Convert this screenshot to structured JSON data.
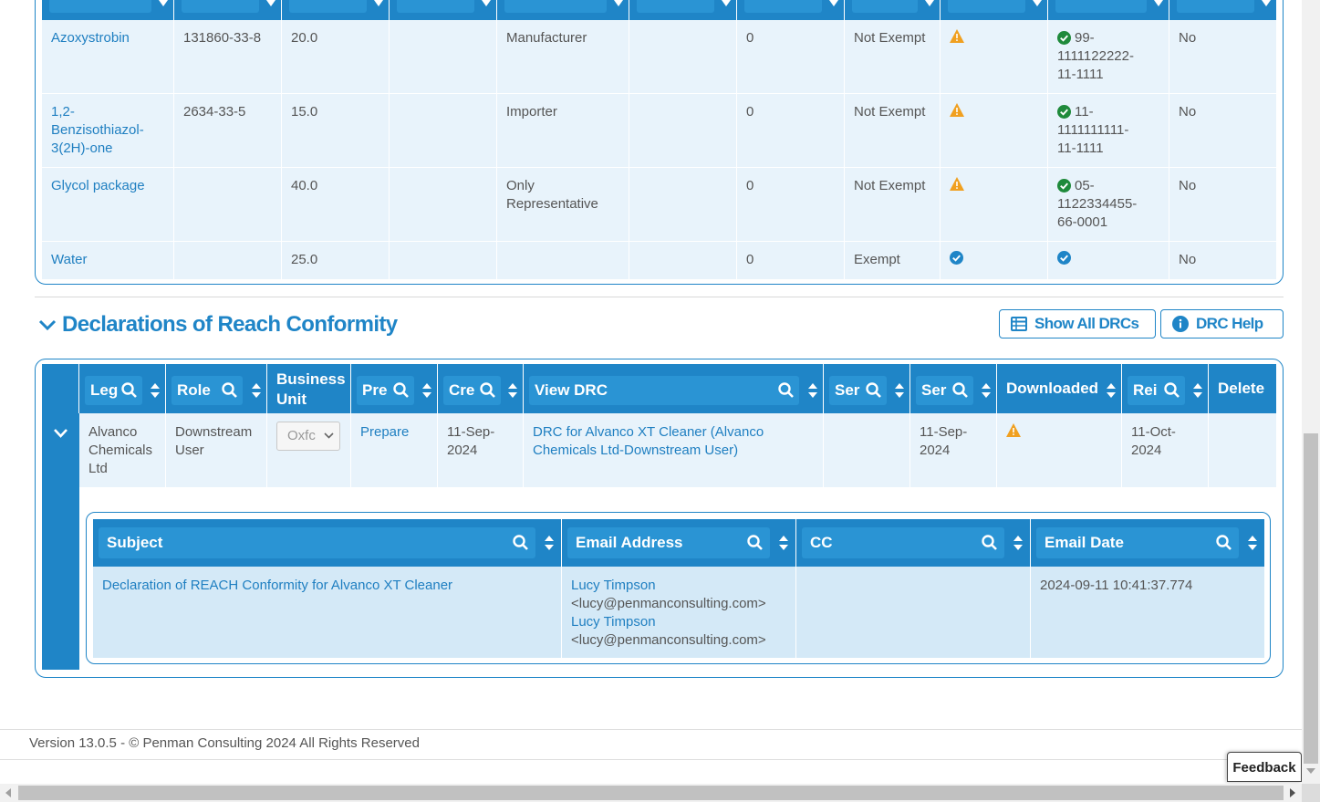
{
  "substances": {
    "rows": [
      {
        "name": "Azoxystrobin",
        "cas": "131860-33-8",
        "pct": "20.0",
        "role": "Manufacturer",
        "count": "0",
        "exempt": "Not Exempt",
        "status": "warning",
        "reg_number": "99-\n1111122222-\n11-1111",
        "reg_status": "ok",
        "flag": "No"
      },
      {
        "name": "1,2-\nBenzisothiazol-\n3(2H)-one",
        "cas": "2634-33-5",
        "pct": "15.0",
        "role": "Importer",
        "count": "0",
        "exempt": "Not Exempt",
        "status": "warning",
        "reg_number": "11-\n1111111111-\n11-1111",
        "reg_status": "ok",
        "flag": "No"
      },
      {
        "name": "Glycol package",
        "cas": "",
        "pct": "40.0",
        "role": "Only\nRepresentative",
        "count": "0",
        "exempt": "Not Exempt",
        "status": "warning",
        "reg_number": "05-\n1122334455-\n66-0001",
        "reg_status": "ok",
        "flag": "No"
      },
      {
        "name": "Water",
        "cas": "",
        "pct": "25.0",
        "role": "",
        "count": "0",
        "exempt": "Exempt",
        "status": "verified",
        "reg_number": "",
        "reg_status": "verified",
        "flag": "No"
      }
    ]
  },
  "section": {
    "title": "Declarations of Reach Conformity",
    "show_all_label": "Show All DRCs",
    "help_label": "DRC Help"
  },
  "drc_table": {
    "headers": {
      "legal": "Leg",
      "role": "Role",
      "business_unit": "Business\nUnit",
      "prepare": "Pre",
      "created": "Cre",
      "view": "View DRC",
      "sent1": "Ser",
      "sent2": "Ser",
      "downloaded": "Downloaded",
      "reminder": "Rei",
      "delete": "Delete"
    },
    "row": {
      "legal": "Alvanco\nChemicals\nLtd",
      "role": "Downstream\nUser",
      "business_unit": "Oxfc",
      "prepare": "Prepare",
      "created": "11-Sep-\n2024",
      "view": "DRC for Alvanco XT Cleaner (Alvanco\nChemicals Ltd-Downstream User)",
      "sent1": "",
      "sent2": "11-Sep-\n2024",
      "downloaded_status": "warning",
      "reminder": "11-Oct-\n2024",
      "delete": ""
    },
    "email_table": {
      "headers": {
        "subject": "Subject",
        "email": "Email Address",
        "cc": "CC",
        "date": "Email Date"
      },
      "row": {
        "subject": "Declaration of REACH Conformity for Alvanco XT Cleaner",
        "email_name_1": "Lucy Timpson",
        "email_addr_1": "<lucy@penmanconsulting.com>",
        "email_name_2": "Lucy Timpson",
        "email_addr_2": "<lucy@penmanconsulting.com>",
        "cc": "",
        "date": "2024-09-11 10:41:37.774"
      }
    }
  },
  "footer": {
    "text": "Version 13.0.5 - © Penman Consulting 2024 All Rights Reserved",
    "feedback": "Feedback"
  },
  "colors": {
    "primary": "#1f85c7",
    "row_bg": "#e8f3fb",
    "warning": "#f0a020",
    "ok": "#1f8a3b"
  }
}
